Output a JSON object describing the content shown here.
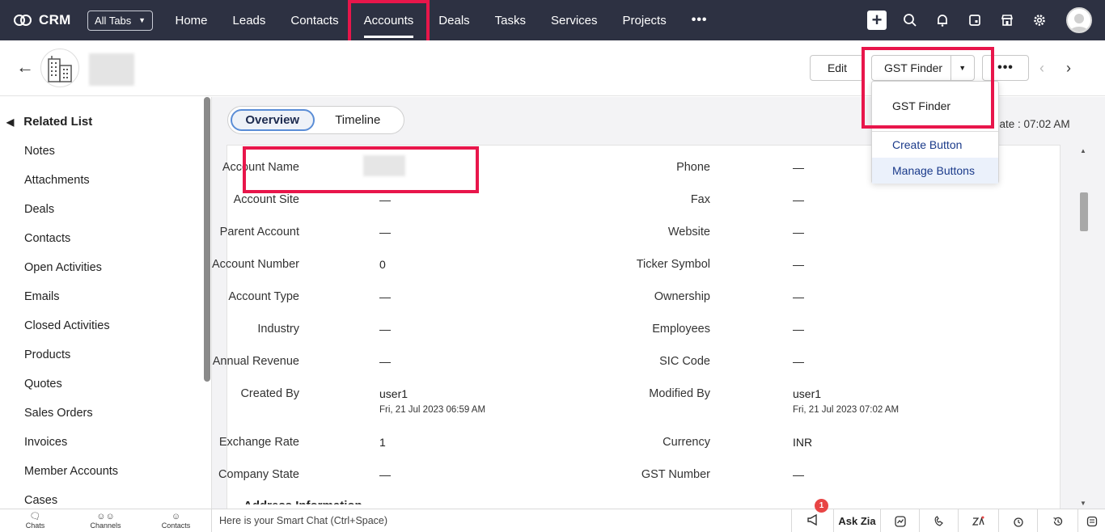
{
  "app": {
    "name": "CRM",
    "all_tabs_label": "All Tabs"
  },
  "nav": {
    "tabs": [
      "Home",
      "Leads",
      "Contacts",
      "Accounts",
      "Deals",
      "Tasks",
      "Services",
      "Projects"
    ],
    "active_tab": "Accounts",
    "more_label": "•••"
  },
  "header": {
    "back_icon": "arrow-left-icon",
    "avatar_icon": "building-icon",
    "edit_label": "Edit",
    "gst_finder_label": "GST Finder",
    "more_label": "•••"
  },
  "dropdown": {
    "items": [
      "GST Finder",
      "Create Button",
      "Manage Buttons"
    ],
    "hovered": "Manage Buttons"
  },
  "sidebar": {
    "title": "Related List",
    "items": [
      "Notes",
      "Attachments",
      "Deals",
      "Contacts",
      "Open Activities",
      "Emails",
      "Closed Activities",
      "Products",
      "Quotes",
      "Sales Orders",
      "Invoices",
      "Member Accounts",
      "Cases"
    ]
  },
  "view_toggle": {
    "overview": "Overview",
    "timeline": "Timeline",
    "active": "Overview"
  },
  "last_update_text": "date : 07:02 AM",
  "fields": {
    "left": [
      {
        "label": "Account Name",
        "value": ""
      },
      {
        "label": "Account Site",
        "value": "—"
      },
      {
        "label": "Parent Account",
        "value": "—"
      },
      {
        "label": "Account Number",
        "value": "0"
      },
      {
        "label": "Account Type",
        "value": "—"
      },
      {
        "label": "Industry",
        "value": "—"
      },
      {
        "label": "Annual Revenue",
        "value": "—"
      },
      {
        "label": "Created By",
        "value": "user1",
        "sub": "Fri, 21 Jul 2023 06:59 AM"
      },
      {
        "label": "Exchange Rate",
        "value": "1"
      },
      {
        "label": "Company State",
        "value": "—"
      }
    ],
    "right": [
      {
        "label": "Phone",
        "value": "—"
      },
      {
        "label": "Fax",
        "value": "—"
      },
      {
        "label": "Website",
        "value": "—"
      },
      {
        "label": "Ticker Symbol",
        "value": "—"
      },
      {
        "label": "Ownership",
        "value": "—"
      },
      {
        "label": "Employees",
        "value": "—"
      },
      {
        "label": "SIC Code",
        "value": "—"
      },
      {
        "label": "Modified By",
        "value": "user1",
        "sub": "Fri, 21 Jul 2023 07:02 AM"
      },
      {
        "label": "Currency",
        "value": "INR"
      },
      {
        "label": "GST Number",
        "value": "—"
      }
    ]
  },
  "section_peek": "Address Information",
  "bottom_bar": {
    "tabs": [
      "Chats",
      "Channels",
      "Contacts"
    ],
    "smart_chat": "Here is your Smart Chat (Ctrl+Space)",
    "ask_zia": "Ask Zia",
    "notification_count": "1"
  },
  "colors": {
    "topnav_bg": "#2d3142",
    "highlight": "#e8164b",
    "link_blue": "#1a3a8a"
  }
}
